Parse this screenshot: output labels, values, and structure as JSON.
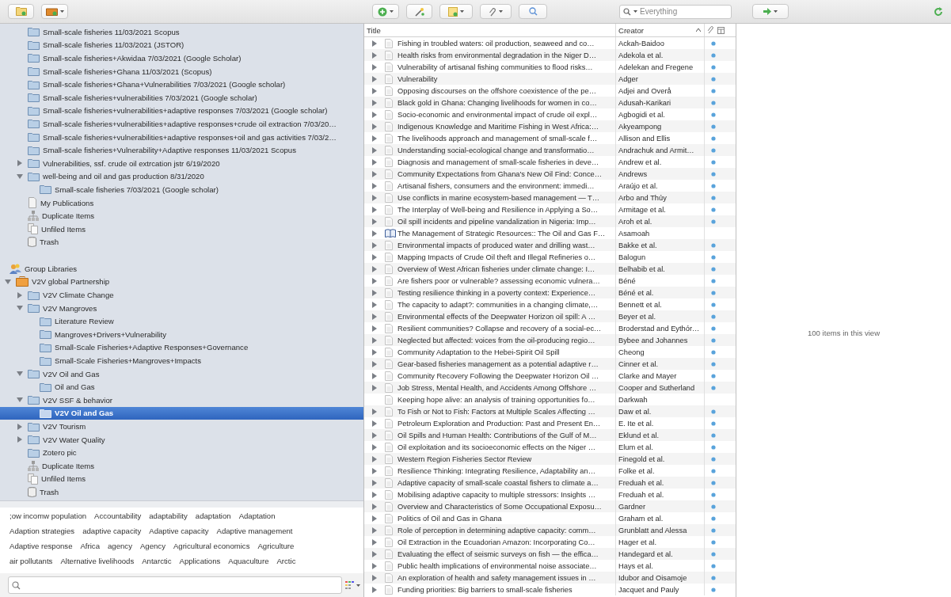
{
  "toolbar": {
    "search": {
      "placeholder": "Everything"
    }
  },
  "my_library": [
    {
      "kind": "folder",
      "label": "Small-scale fisheries 11/03/2021  Scopus"
    },
    {
      "kind": "folder",
      "label": "Small-scale fisheries 11/03/2021 (JSTOR)"
    },
    {
      "kind": "folder",
      "label": "Small-scale fisheries+Akwidaa 7/03/2021 (Google Scholar)"
    },
    {
      "kind": "folder",
      "label": "Small-scale fisheries+Ghana 11/03/2021 (Scopus)"
    },
    {
      "kind": "folder",
      "label": "Small-scale fisheries+Ghana+Vulnerabilities 7/03/2021 (Google scholar)"
    },
    {
      "kind": "folder",
      "label": "Small-scale fisheries+vulnerabilities 7/03/2021 (Google scholar)"
    },
    {
      "kind": "folder",
      "label": "Small-scale fisheries+vulnerabilities+adaptive responses 7/03/2021 (Google scholar)"
    },
    {
      "kind": "folder",
      "label": "Small-scale fisheries+vulnerabilities+adaptive responses+crude oil extraction 7/03/20…"
    },
    {
      "kind": "folder",
      "label": "Small-scale fisheries+vulnerabilities+adaptive responses+oil and gas activities 7/03/2…"
    },
    {
      "kind": "folder",
      "label": "Small-scale fisheries+Vulnerability+Adaptive responses 11/03/2021 Scopus"
    },
    {
      "kind": "folder",
      "label": "Vulnerabilities, ssf. crude oil extrcation jstr 6/19/2020",
      "expanded": false
    },
    {
      "kind": "folder",
      "label": "well-being and oil and gas production 8/31/2020",
      "expanded": true,
      "children": [
        {
          "kind": "folder",
          "label": "Small-scale fisheries 7/03/2021 (Google scholar)"
        }
      ]
    },
    {
      "kind": "publications",
      "label": "My Publications"
    },
    {
      "kind": "duplicates",
      "label": "Duplicate Items"
    },
    {
      "kind": "unfiled",
      "label": "Unfiled Items"
    },
    {
      "kind": "trash",
      "label": "Trash"
    }
  ],
  "group_libraries": {
    "label": "Group Libraries",
    "groups": [
      {
        "kind": "group",
        "label": "V2V global Partnership",
        "expanded": true,
        "children": [
          {
            "kind": "folder",
            "label": "V2V Climate Change",
            "expanded": false
          },
          {
            "kind": "folder",
            "label": "V2V Mangroves",
            "expanded": true,
            "children": [
              {
                "kind": "folder",
                "label": "Literature Review"
              },
              {
                "kind": "folder",
                "label": "Mangroves+Drivers+Vulnerability"
              },
              {
                "kind": "folder",
                "label": "Small-Scale Fisheries+Adaptive Responses+Governance"
              },
              {
                "kind": "folder",
                "label": "Small-Scale Fisheries+Mangroves+Impacts"
              }
            ]
          },
          {
            "kind": "folder",
            "label": "V2V Oil and Gas",
            "expanded": true,
            "children": [
              {
                "kind": "folder",
                "label": "Oil and Gas"
              }
            ]
          },
          {
            "kind": "folder",
            "label": "V2V SSF & behavior",
            "expanded": true,
            "children": [
              {
                "kind": "folder",
                "label": "V2V Oil and Gas",
                "selected": true
              }
            ]
          },
          {
            "kind": "folder",
            "label": "V2V Tourism",
            "expanded": false
          },
          {
            "kind": "folder",
            "label": "V2V Water Quality",
            "expanded": false
          },
          {
            "kind": "folder",
            "label": "Zotero  pic"
          },
          {
            "kind": "duplicates",
            "label": "Duplicate Items"
          },
          {
            "kind": "unfiled",
            "label": "Unfiled Items"
          },
          {
            "kind": "trash",
            "label": "Trash"
          }
        ]
      }
    ]
  },
  "tag_rows": [
    [
      ";ow incomw population",
      "Accountability",
      "adaptability",
      "adaptation",
      "Adaptation"
    ],
    [
      "Adaption strategies",
      "adaptive capacity",
      "Adaptive capacity",
      "Adaptive management"
    ],
    [
      "Adaptive response",
      "Africa",
      "agency",
      "Agency",
      "Agricultural economics",
      "Agriculture"
    ],
    [
      "air pollutants",
      "Alternative livelihoods",
      "Antarctic",
      "Applications",
      "Aquaculture",
      "Arctic"
    ]
  ],
  "items_table": {
    "columns": [
      "Title",
      "Creator"
    ],
    "rows": [
      {
        "kind": "article",
        "has_children": true,
        "attachment": true,
        "title": "Fishing in troubled waters: oil production, seaweed and co…",
        "creator": "Ackah-Baidoo"
      },
      {
        "kind": "article",
        "has_children": true,
        "attachment": true,
        "title": "Health risks from environmental degradation in the Niger D…",
        "creator": "Adekola et al."
      },
      {
        "kind": "article",
        "has_children": true,
        "attachment": true,
        "title": "Vulnerability of artisanal fishing communities to flood risks…",
        "creator": "Adelekan and Fregene"
      },
      {
        "kind": "article",
        "has_children": true,
        "attachment": true,
        "title": "Vulnerability",
        "creator": "Adger"
      },
      {
        "kind": "article",
        "has_children": true,
        "attachment": true,
        "title": "Opposing discourses on the offshore coexistence of the pe…",
        "creator": "Adjei and Overå"
      },
      {
        "kind": "article",
        "has_children": true,
        "attachment": true,
        "title": "Black gold in Ghana: Changing livelihoods for women in co…",
        "creator": "Adusah-Karikari"
      },
      {
        "kind": "article",
        "has_children": true,
        "attachment": true,
        "title": "Socio-economic and environmental impact of crude oil expl…",
        "creator": "Agbogidi et al."
      },
      {
        "kind": "article",
        "has_children": true,
        "attachment": true,
        "title": "Indigenous Knowledge and Maritime Fishing in West Africa:…",
        "creator": "Akyeampong"
      },
      {
        "kind": "article",
        "has_children": true,
        "attachment": true,
        "title": "The livelihoods approach and management of small-scale f…",
        "creator": "Allison and Ellis"
      },
      {
        "kind": "article",
        "has_children": true,
        "attachment": true,
        "title": "Understanding social-ecological change and transformatio…",
        "creator": "Andrachuk and Armit…"
      },
      {
        "kind": "article",
        "has_children": true,
        "attachment": true,
        "title": "Diagnosis and management of small-scale fisheries in deve…",
        "creator": "Andrew et al."
      },
      {
        "kind": "article",
        "has_children": true,
        "attachment": true,
        "title": "Community Expectations from Ghana's New Oil Find: Conce…",
        "creator": "Andrews"
      },
      {
        "kind": "article",
        "has_children": true,
        "attachment": true,
        "title": "Artisanal fishers, consumers and the environment: immedi…",
        "creator": "Araújo et al."
      },
      {
        "kind": "article",
        "has_children": true,
        "attachment": true,
        "title": "Use conflicts in marine ecosystem-based management — T…",
        "creator": "Arbo and Thủy"
      },
      {
        "kind": "article",
        "has_children": true,
        "attachment": true,
        "title": "The Interplay of Well-being and Resilience in Applying a So…",
        "creator": "Armitage et al."
      },
      {
        "kind": "article",
        "has_children": true,
        "attachment": true,
        "title": "Oil spill incidents and pipeline vandalization in Nigeria: Imp…",
        "creator": "Aroh et al."
      },
      {
        "kind": "book",
        "has_children": true,
        "attachment": false,
        "title": "The Management of Strategic Resources:: The Oil and Gas F…",
        "creator": "Asamoah"
      },
      {
        "kind": "article",
        "has_children": true,
        "attachment": true,
        "title": "Environmental impacts of produced water and drilling wast…",
        "creator": "Bakke et al."
      },
      {
        "kind": "article",
        "has_children": true,
        "attachment": true,
        "title": "Mapping Impacts of Crude Oil theft and Illegal Refineries o…",
        "creator": "Balogun"
      },
      {
        "kind": "article",
        "has_children": true,
        "attachment": true,
        "title": "Overview of West African fisheries under climate change: I…",
        "creator": "Belhabib et al."
      },
      {
        "kind": "article",
        "has_children": true,
        "attachment": true,
        "title": "Are fishers poor or vulnerable? assessing economic vulnera…",
        "creator": "Béné"
      },
      {
        "kind": "article",
        "has_children": true,
        "attachment": true,
        "title": "Testing resilience thinking in a poverty context: Experience…",
        "creator": "Béné et al."
      },
      {
        "kind": "article",
        "has_children": true,
        "attachment": true,
        "title": "The capacity to adapt?: communities in a changing climate,…",
        "creator": "Bennett et al."
      },
      {
        "kind": "article",
        "has_children": true,
        "attachment": true,
        "title": "Environmental effects of the Deepwater Horizon oil spill: A …",
        "creator": "Beyer et al."
      },
      {
        "kind": "article",
        "has_children": true,
        "attachment": true,
        "title": "Resilient communities? Collapse and recovery of a social-ec…",
        "creator": "Broderstad and Eythór…"
      },
      {
        "kind": "article",
        "has_children": true,
        "attachment": true,
        "title": "Neglected but affected: voices from the oil-producing regio…",
        "creator": "Bybee and Johannes"
      },
      {
        "kind": "article",
        "has_children": true,
        "attachment": true,
        "title": "Community Adaptation to the Hebei-Spirit Oil Spill",
        "creator": "Cheong"
      },
      {
        "kind": "article",
        "has_children": true,
        "attachment": true,
        "title": "Gear-based fisheries management as a potential adaptive r…",
        "creator": "Cinner et al."
      },
      {
        "kind": "article",
        "has_children": true,
        "attachment": true,
        "title": "Community Recovery Following the Deepwater Horizon Oil …",
        "creator": "Clarke and Mayer"
      },
      {
        "kind": "article",
        "has_children": true,
        "attachment": true,
        "title": "Job Stress, Mental Health, and Accidents Among Offshore …",
        "creator": "Cooper and Sutherland"
      },
      {
        "kind": "article",
        "has_children": false,
        "attachment": false,
        "title": "Keeping hope alive: an analysis of training opportunities fo…",
        "creator": "Darkwah"
      },
      {
        "kind": "article",
        "has_children": true,
        "attachment": true,
        "title": "To Fish or Not to Fish: Factors at Multiple Scales Affecting …",
        "creator": "Daw et al."
      },
      {
        "kind": "article",
        "has_children": true,
        "attachment": true,
        "title": "Petroleum Exploration and Production: Past and Present En…",
        "creator": "E. Ite et al."
      },
      {
        "kind": "article",
        "has_children": true,
        "attachment": true,
        "title": "Oil Spills and Human Health: Contributions of the Gulf of M…",
        "creator": "Eklund et al."
      },
      {
        "kind": "article",
        "has_children": true,
        "attachment": true,
        "title": "Oil exploitation and its socioeconomic effects on the Niger …",
        "creator": "Elum et al."
      },
      {
        "kind": "article",
        "has_children": true,
        "attachment": true,
        "title": "Western Region Fisheries Sector Review",
        "creator": "Finegold et al."
      },
      {
        "kind": "article",
        "has_children": true,
        "attachment": true,
        "title": "Resilience Thinking: Integrating Resilience, Adaptability an…",
        "creator": "Folke et al."
      },
      {
        "kind": "article",
        "has_children": true,
        "attachment": true,
        "title": "Adaptive capacity of small-scale coastal fishers to climate a…",
        "creator": "Freduah et al."
      },
      {
        "kind": "article",
        "has_children": true,
        "attachment": true,
        "title": "Mobilising adaptive capacity to multiple stressors: Insights …",
        "creator": "Freduah et al."
      },
      {
        "kind": "article",
        "has_children": true,
        "attachment": true,
        "title": "Overview and Characteristics of Some Occupational Exposu…",
        "creator": "Gardner"
      },
      {
        "kind": "article",
        "has_children": true,
        "attachment": true,
        "title": "Politics of Oil and Gas in Ghana",
        "creator": "Graham et al."
      },
      {
        "kind": "article",
        "has_children": true,
        "attachment": true,
        "title": "Role of perception in determining adaptive capacity: comm…",
        "creator": "Grunblatt and Alessa"
      },
      {
        "kind": "article",
        "has_children": true,
        "attachment": true,
        "title": "Oil Extraction in the Ecuadorian Amazon: Incorporating Co…",
        "creator": "Hager et al."
      },
      {
        "kind": "article",
        "has_children": true,
        "attachment": true,
        "title": "Evaluating the effect of seismic surveys on fish — the effica…",
        "creator": "Handegard et al."
      },
      {
        "kind": "article",
        "has_children": true,
        "attachment": true,
        "title": "Public health implications of environmental noise associate…",
        "creator": "Hays et al."
      },
      {
        "kind": "article",
        "has_children": true,
        "attachment": true,
        "title": "An exploration of health and safety management issues in …",
        "creator": "Idubor and Oisamoje"
      },
      {
        "kind": "article",
        "has_children": true,
        "attachment": true,
        "title": "Funding priorities: Big barriers to small-scale fisheries",
        "creator": "Jacquet and Pauly"
      }
    ]
  },
  "item_pane": {
    "message": "100 items in this view"
  }
}
